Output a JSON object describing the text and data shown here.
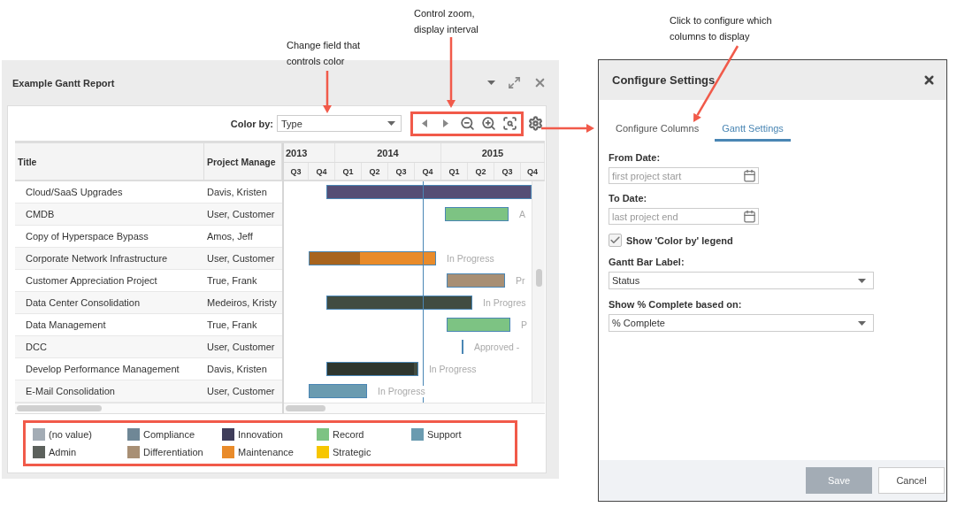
{
  "annotations": {
    "color_field": [
      "Change field that",
      "controls color"
    ],
    "zoom": [
      "Control zoom,",
      "display interval"
    ],
    "columns": [
      "Click to configure which",
      "columns to display"
    ]
  },
  "report": {
    "title": "Example Gantt Report",
    "color_by": {
      "label": "Color by:",
      "value": "Type"
    },
    "columns": [
      "Title",
      "Project Manage"
    ],
    "rows": [
      {
        "title": "Cloud/SaaS Upgrades",
        "manager": "Davis, Kristen",
        "kind": "bar",
        "color": "#554e75"
      },
      {
        "title": "CMDB",
        "manager": "User, Customer",
        "kind": "bar",
        "color": "#7dc383",
        "bar_label": "A"
      },
      {
        "title": "Copy of Hyperspace Bypass",
        "manager": "Amos, Jeff",
        "kind": "none"
      },
      {
        "title": "Corporate Network Infrastructure",
        "manager": "User, Customer",
        "kind": "bar",
        "color": "#e98b2a",
        "level": 0.4,
        "bar_label": "In Progress"
      },
      {
        "title": "Customer Appreciation Project",
        "manager": "True, Frank",
        "kind": "bar",
        "color": "#a88f74",
        "bar_label": "Pr"
      },
      {
        "title": "Data Center Consolidation",
        "manager": "Medeiros, Kristy",
        "kind": "bar",
        "color": "#414c41",
        "bar_label": "In Progres"
      },
      {
        "title": "Data Management",
        "manager": "True, Frank",
        "kind": "bar",
        "color": "#7dc383",
        "bar_label": "P"
      },
      {
        "title": "DCC",
        "manager": "User, Customer",
        "kind": "milestone",
        "color": "#4a86b4",
        "bar_label": "Approved -"
      },
      {
        "title": "Develop Performance Management",
        "manager": "Davis, Kristen",
        "kind": "bar",
        "color": "#414c41",
        "level": 0.96,
        "bar_label": "In Progress"
      },
      {
        "title": "E-Mail Consolidation",
        "manager": "User, Customer",
        "kind": "bar",
        "color": "#6a9bb0",
        "bar_label": "In Progress"
      }
    ],
    "years": [
      "2013",
      "2014",
      "2015"
    ],
    "quarters": [
      "Q3",
      "Q4",
      "Q1",
      "Q2",
      "Q3",
      "Q4",
      "Q1",
      "Q2",
      "Q3",
      "Q4"
    ],
    "legend": [
      {
        "label": "(no value)",
        "color": "#a3acb5"
      },
      {
        "label": "Compliance",
        "color": "#6f8796"
      },
      {
        "label": "Innovation",
        "color": "#3f3d5a"
      },
      {
        "label": "Record",
        "color": "#7dc383"
      },
      {
        "label": "Support",
        "color": "#6a9bb0"
      },
      {
        "label": "Admin",
        "color": "#5c615c"
      },
      {
        "label": "Differentiation",
        "color": "#a88f74"
      },
      {
        "label": "Maintenance",
        "color": "#e98b2a"
      },
      {
        "label": "Strategic",
        "color": "#f7c600"
      }
    ]
  },
  "dialog": {
    "title": "Configure Settings",
    "tabs": [
      {
        "label": "Configure Columns",
        "selected": false
      },
      {
        "label": "Gantt Settings",
        "selected": true
      }
    ],
    "from_date": {
      "label": "From Date:",
      "placeholder": "first project start"
    },
    "to_date": {
      "label": "To Date:",
      "placeholder": "last project end"
    },
    "legend_checkbox": {
      "label": "Show 'Color by' legend",
      "checked": true
    },
    "bar_label": {
      "label": "Gantt Bar Label:",
      "value": "Status"
    },
    "complete_basis": {
      "label": "Show % Complete based on:",
      "value": "% Complete"
    },
    "buttons": [
      {
        "label": "Save",
        "disabled": true
      },
      {
        "label": "Cancel",
        "disabled": false
      }
    ]
  }
}
